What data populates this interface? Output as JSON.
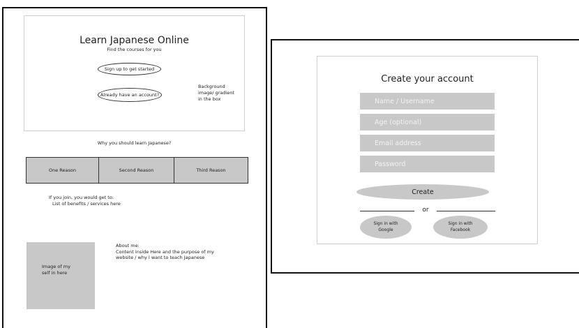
{
  "landing": {
    "hero": {
      "title": "Learn Japanese Online",
      "subtitle": "Find the courses for you",
      "signup_button": "Sign up to get started",
      "login_button": "Already have an account?",
      "background_note": [
        "Background",
        "image/ gradient",
        "in the box"
      ]
    },
    "why_title": "Why you should learn Japanese?",
    "reasons": [
      "One Reason",
      "Second Reason",
      "Third Reason"
    ],
    "benefits": [
      "If you join, you would get to:",
      "List of benefits / services here"
    ],
    "photo_label": [
      "Image of my",
      "self in here"
    ],
    "about": {
      "heading": "About me:",
      "lines": [
        "Content Inside Here and the purpose of my",
        "website / why I want to teach Japanese"
      ]
    }
  },
  "signup": {
    "title": "Create your account",
    "fields": {
      "name_placeholder": "Name / Username",
      "age_placeholder": "Age (optional)",
      "email_placeholder": "Email address",
      "password_placeholder": "Password"
    },
    "create_button": "Create",
    "or_label": "or",
    "google_button": [
      "Sign in with",
      "Google"
    ],
    "facebook_button": [
      "Sign in with",
      "Facebook"
    ]
  },
  "colors": {
    "placeholder_gray": "#c8c8c8",
    "frame_border": "#111111",
    "card_border": "#cfcfcf"
  }
}
